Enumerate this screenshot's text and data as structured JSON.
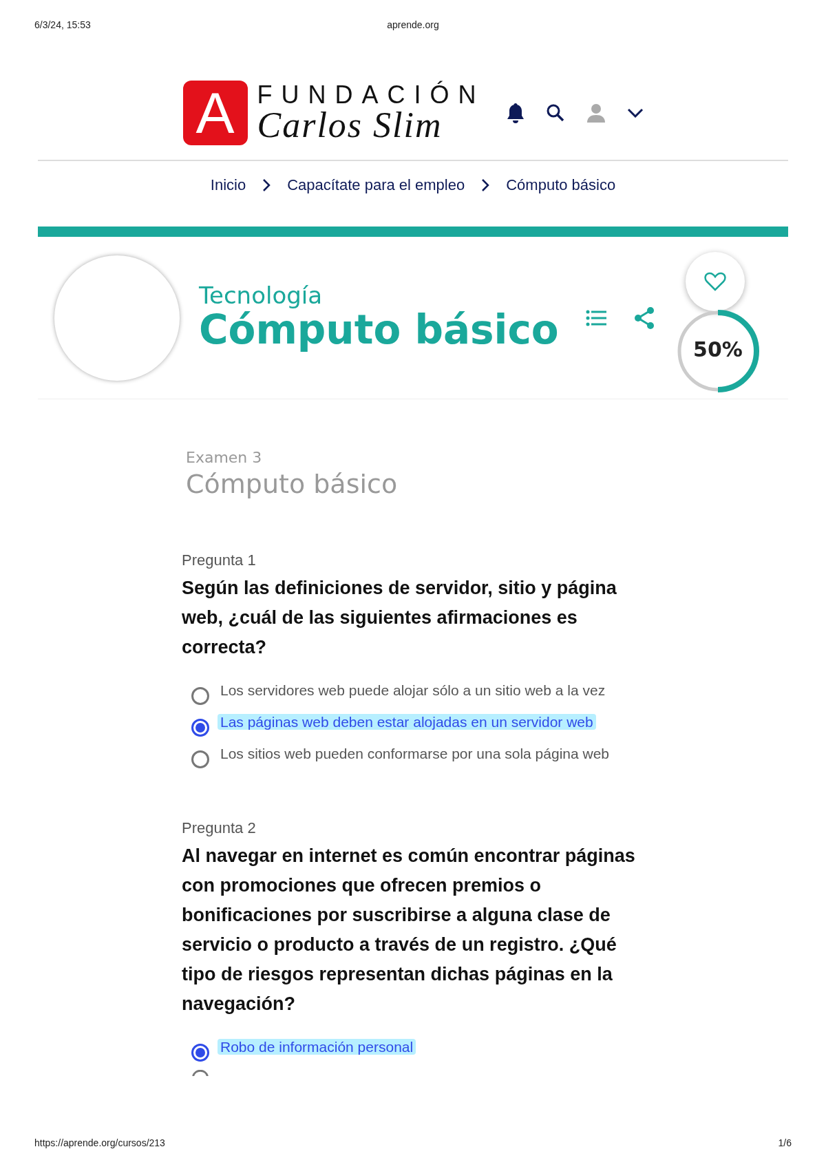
{
  "print_header": {
    "date": "6/3/24, 15:53",
    "site": "aprende.org"
  },
  "logo": {
    "mark": "A",
    "line1": "FUNDACIÓN",
    "line2": "Carlos Slim"
  },
  "breadcrumb": [
    {
      "label": "Inicio"
    },
    {
      "label": "Capacítate para el empleo"
    },
    {
      "label": "Cómputo básico"
    }
  ],
  "course": {
    "category": "Tecnología",
    "title": "Cómputo básico",
    "progress": {
      "level": 0.5,
      "label": "50%"
    }
  },
  "exam": {
    "subtitle": "Examen 3",
    "title": "Cómputo básico"
  },
  "questions": [
    {
      "number": "Pregunta 1",
      "text": "Según las definiciones de servidor, sitio y página web, ¿cuál de las siguientes afirmaciones es correcta?",
      "options": [
        {
          "label": "Los servidores web puede alojar sólo a un sitio web a la vez",
          "selected": false
        },
        {
          "label": "Las páginas web deben estar alojadas en un servidor web",
          "selected": true
        },
        {
          "label": "Los sitios web pueden conformarse por una sola página web",
          "selected": false
        }
      ]
    },
    {
      "number": "Pregunta 2",
      "text": "Al navegar en internet es común encontrar páginas con promociones que ofrecen premios o bonificaciones por suscribirse a alguna clase de servicio o producto a través de un registro. ¿Qué tipo de riesgos representan dichas páginas en la navegación?",
      "options": [
        {
          "label": "Robo de información personal",
          "selected": true
        },
        {
          "selected": false
        }
      ]
    }
  ],
  "print_footer": {
    "url": "https://aprende.org/cursos/213",
    "page": "1/6"
  }
}
